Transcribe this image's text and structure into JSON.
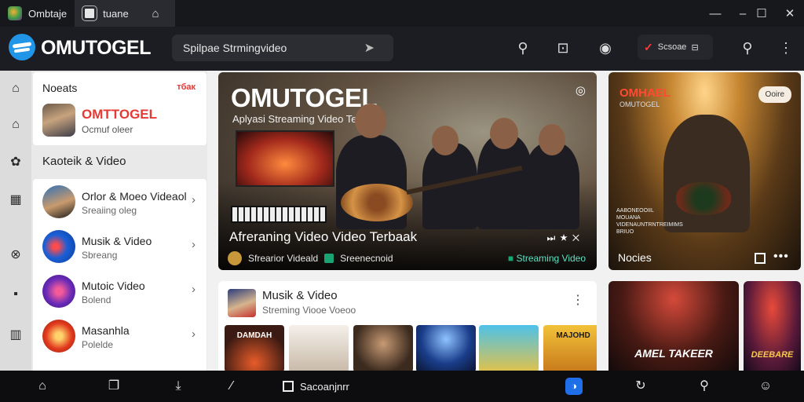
{
  "tabs": [
    {
      "label": "Ombtaje",
      "icon": "app-icon"
    },
    {
      "label": "tuane",
      "icon": "page-icon"
    }
  ],
  "window_controls": [
    "minimize-icon",
    "maximize-icon",
    "close-icon"
  ],
  "header": {
    "brand": "OMUTOGEL",
    "search_value": "Spilpae Strmingvideo",
    "pill_label": "Scsoae"
  },
  "sidebar": {
    "news_title": "Noeats",
    "news_badge": "тбак",
    "news_name": "OMTTOGEL",
    "news_sub": "Ocmuf oleer",
    "section_title": "Kaoteik & Video",
    "items": [
      {
        "title": "Orlor & Moeo Videaol",
        "sub": "Sreaiing oleg"
      },
      {
        "title": "Musik & Video",
        "sub": "Sbreang"
      },
      {
        "title": "Mutoic Video",
        "sub": "Bolend"
      },
      {
        "title": "Masanhla",
        "sub": "Polelde"
      }
    ]
  },
  "hero": {
    "title": "OMUTOGEL",
    "subtitle": "Aplyasi Streaming Video Terbaak",
    "caption": "Afreraning Video  Video Terbaak",
    "meta_author": "Sfrearior Videald",
    "meta_channel": "Sreenecnoid",
    "tag": "Streaming Video"
  },
  "concert": {
    "title": "OMHAEL",
    "subtitle": "OMUTOGEL",
    "pill": "Ooire",
    "label": "Nocies",
    "fine_print": "AABONEOOIIL MOUANA VIDENAUNTRNTREIMIMS BRIUO"
  },
  "music_card": {
    "title": "Musik & Video",
    "subtitle": "Streming Viooe Voeoo",
    "posters": [
      "DAMDAH",
      "",
      "",
      "",
      "",
      "MAJOHD"
    ]
  },
  "tiles": [
    {
      "text": "AMEL TAKEER"
    },
    {
      "text": "DEEBARE"
    }
  ],
  "taskbar": {
    "app_label": "Sacoanjnrr"
  }
}
